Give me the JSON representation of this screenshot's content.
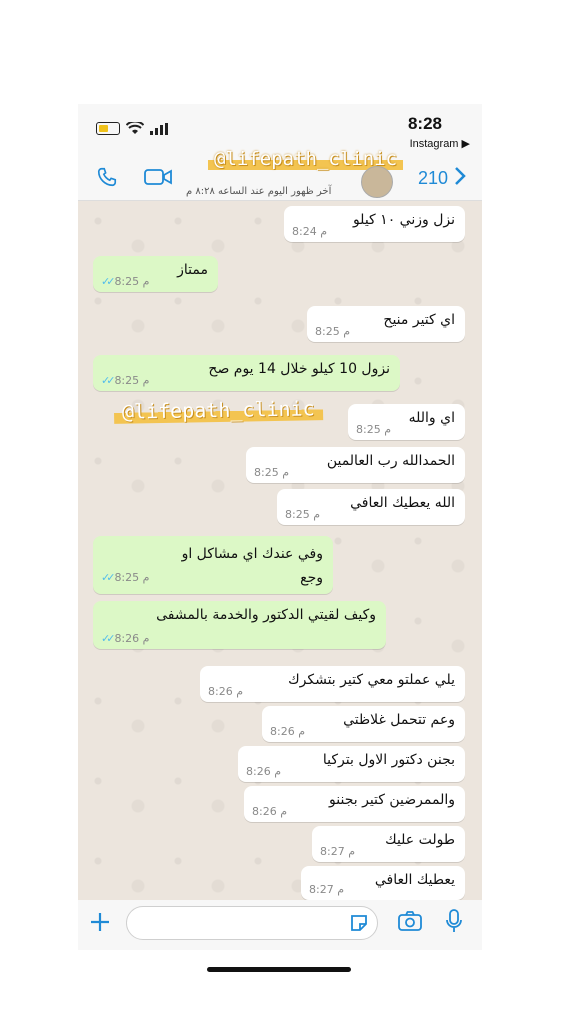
{
  "status": {
    "time": "8:28",
    "source_app": "Instagram ▶"
  },
  "header": {
    "unread_count": "210",
    "handle_overlay": "@lifepath_clinic",
    "last_seen": "آخر ظهور اليوم عند الساعه ٨:٢٨ م"
  },
  "watermark": "@lifepath_clinic",
  "messages": [
    {
      "dir": "in",
      "text": "نزل وزني ١٠ كيلو",
      "time": "8:24 م"
    },
    {
      "dir": "out",
      "text": "ممتاز",
      "time": "8:25 م"
    },
    {
      "dir": "in",
      "text": "اي كتير منيح",
      "time": "8:25 م"
    },
    {
      "dir": "out",
      "text": "نزول 10 كيلو خلال 14 يوم صح",
      "time": "8:25 م"
    },
    {
      "dir": "in",
      "text": "اي والله",
      "time": "8:25 م"
    },
    {
      "dir": "in",
      "text": "الحمدالله رب العالمين",
      "time": "8:25 م"
    },
    {
      "dir": "in",
      "text": "الله يعطيك العافي",
      "time": "8:25 م"
    },
    {
      "dir": "out",
      "text": "وفي عندك اي مشاكل او وجع",
      "time": "8:25 م"
    },
    {
      "dir": "out",
      "text": "وكيف لقيتي الدكتور والخدمة بالمشفى",
      "time": "8:26 م"
    },
    {
      "dir": "in",
      "text": "يلي عملتو معي كتير بتشكرك",
      "time": "8:26 م"
    },
    {
      "dir": "in",
      "text": "وعم تتحمل غلاظتي",
      "time": "8:26 م"
    },
    {
      "dir": "in",
      "text": "بجنن دكتور الاول بتركيا",
      "time": "8:26 م"
    },
    {
      "dir": "in",
      "text": "والممرضين كتير بجننو",
      "time": "8:26 م"
    },
    {
      "dir": "in",
      "text": "طولت عليك",
      "time": "8:27 م"
    },
    {
      "dir": "in",
      "text": "يعطيك العافي",
      "time": "8:27 م"
    }
  ],
  "icons": [
    "battery-icon",
    "wifi-icon",
    "signal-icon",
    "phone-icon",
    "video-icon",
    "chevron-right-icon",
    "plus-icon",
    "sticker-icon",
    "camera-icon",
    "microphone-icon"
  ]
}
